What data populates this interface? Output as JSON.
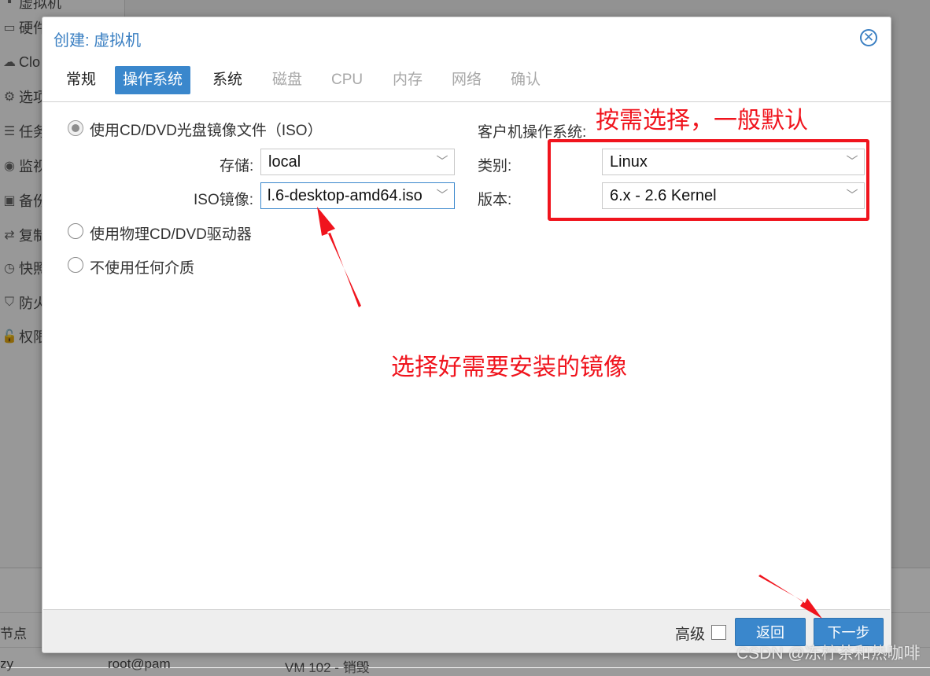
{
  "background": {
    "sidebar_items": [
      {
        "icon": "box-icon",
        "label": "虚拟机"
      },
      {
        "icon": "monitor-icon",
        "label": "硬件"
      },
      {
        "icon": "cloud-icon",
        "label": "Clo"
      },
      {
        "icon": "gear-icon",
        "label": "选项"
      },
      {
        "icon": "list-icon",
        "label": "任务"
      },
      {
        "icon": "eye-icon",
        "label": "监视"
      },
      {
        "icon": "save-icon",
        "label": "备份"
      },
      {
        "icon": "replicate-icon",
        "label": "复制"
      },
      {
        "icon": "clock-icon",
        "label": "快照"
      },
      {
        "icon": "shield-icon",
        "label": "防火"
      },
      {
        "icon": "lock-icon",
        "label": "权限"
      }
    ],
    "bottom_cells": {
      "node_label": "节点",
      "user": "root@pam",
      "description": "VM 102 - 销毁",
      "row_prefix": "zy"
    }
  },
  "dialog": {
    "title": "创建: 虚拟机",
    "close_glyph": "✕",
    "tabs": [
      {
        "label": "常规",
        "state": "normal"
      },
      {
        "label": "操作系统",
        "state": "active"
      },
      {
        "label": "系统",
        "state": "normal"
      },
      {
        "label": "磁盘",
        "state": "disabled"
      },
      {
        "label": "CPU",
        "state": "disabled"
      },
      {
        "label": "内存",
        "state": "disabled"
      },
      {
        "label": "网络",
        "state": "disabled"
      },
      {
        "label": "确认",
        "state": "disabled"
      }
    ],
    "media": {
      "option_iso": "使用CD/DVD光盘镜像文件（ISO）",
      "storage_label": "存储:",
      "storage_value": "local",
      "iso_label": "ISO镜像:",
      "iso_value": "l.6-desktop-amd64.iso",
      "option_physical": "使用物理CD/DVD驱动器",
      "option_none": "不使用任何介质",
      "selected": "iso"
    },
    "guest_os": {
      "heading": "客户机操作系统:",
      "type_label": "类别:",
      "type_value": "Linux",
      "version_label": "版本:",
      "version_value": "6.x - 2.6 Kernel"
    },
    "footer": {
      "advanced_label": "高级",
      "advanced_checked": false,
      "back_label": "返回",
      "next_label": "下一步"
    }
  },
  "annotations": {
    "box_note": "按需选择，一般默认",
    "iso_note": "选择好需要安装的镜像",
    "color": "#f0141d"
  },
  "watermark": "CSDN @冻柠茶和热咖啡",
  "colors": {
    "accent": "#3a87cc",
    "title": "#3a7fc2",
    "annotation": "#f0141d"
  }
}
